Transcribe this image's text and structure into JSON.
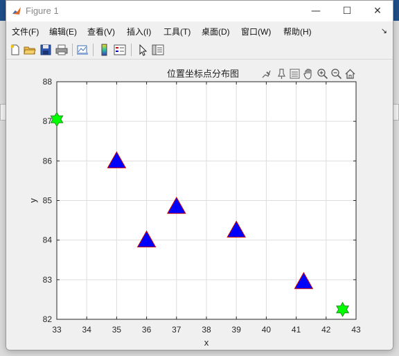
{
  "window": {
    "title": "Figure 1",
    "minimize_glyph": "—",
    "maximize_glyph": "☐",
    "close_glyph": "✕"
  },
  "menu": {
    "items": [
      "文件(F)",
      "编辑(E)",
      "查看(V)",
      "插入(I)",
      "工具(T)",
      "桌面(D)",
      "窗口(W)",
      "帮助(H)"
    ],
    "overflow_glyph": "↘"
  },
  "toolbar": {
    "icons": [
      "new-figure-icon",
      "open-folder-icon",
      "save-icon",
      "print-icon",
      "link-plot-icon",
      "colorbar-icon",
      "legend-icon",
      "edit-pointer-icon",
      "property-inspector-icon"
    ]
  },
  "axes_toolbar": {
    "icons": [
      "brush-icon",
      "data-tips-icon",
      "restore-view-icon",
      "pan-icon",
      "zoom-in-icon",
      "zoom-out-icon",
      "home-icon"
    ]
  },
  "colors": {
    "triangle_fill": "#0000ff",
    "triangle_edge": "#cc0000",
    "star_fill": "#00ff00",
    "star_edge": "#228b22"
  },
  "chart_data": {
    "type": "scatter",
    "title": "位置坐标点分布图",
    "xlabel": "x",
    "ylabel": "y",
    "xlim": [
      33,
      43
    ],
    "ylim": [
      82,
      88
    ],
    "xticks": [
      "33",
      "34",
      "35",
      "36",
      "37",
      "38",
      "39",
      "40",
      "41",
      "42",
      "43"
    ],
    "yticks": [
      "82",
      "83",
      "84",
      "85",
      "86",
      "87",
      "88"
    ],
    "grid": true,
    "series": [
      {
        "marker": "triangle",
        "points": [
          {
            "x": 35,
            "y": 86
          },
          {
            "x": 36,
            "y": 84
          },
          {
            "x": 37,
            "y": 84.85
          },
          {
            "x": 39,
            "y": 84.25
          },
          {
            "x": 41.25,
            "y": 82.95
          }
        ]
      },
      {
        "marker": "hexagram",
        "points": [
          {
            "x": 33,
            "y": 87.05
          },
          {
            "x": 42.55,
            "y": 82.25
          }
        ]
      }
    ]
  }
}
